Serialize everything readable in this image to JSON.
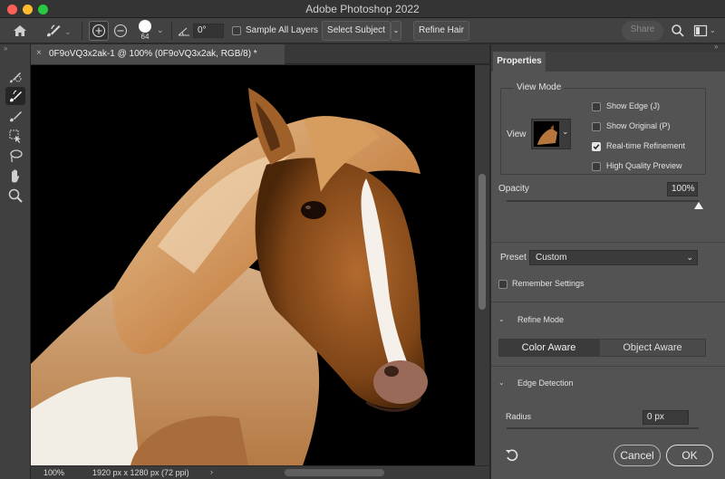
{
  "window": {
    "title": "Adobe Photoshop 2022",
    "traffic_colors": [
      "#ff5f57",
      "#febc2e",
      "#28c840"
    ]
  },
  "options_bar": {
    "brush_size": "64",
    "angle_value": "0°",
    "sample_all_layers_label": "Sample All Layers",
    "sample_all_layers_checked": false,
    "select_subject_label": "Select Subject",
    "refine_hair_label": "Refine Hair",
    "share_label": "Share"
  },
  "document": {
    "tab_title": "0F9oVQ3x2ak-1 @ 100% (0F9oVQ3x2ak, RGB/8) *"
  },
  "toolbar": {
    "tools": [
      {
        "name": "quick-selection-tool-icon",
        "active": false
      },
      {
        "name": "refine-edge-brush-icon",
        "active": true
      },
      {
        "name": "brush-tool-icon",
        "active": false
      },
      {
        "name": "object-selection-tool-icon",
        "active": false
      },
      {
        "name": "lasso-tool-icon",
        "active": false
      },
      {
        "name": "hand-tool-icon",
        "active": false
      },
      {
        "name": "zoom-tool-icon",
        "active": false
      }
    ]
  },
  "status_bar": {
    "zoom": "100%",
    "doc_info": "1920 px x 1280 px (72 ppi)"
  },
  "properties": {
    "tab_label": "Properties",
    "view_mode": {
      "heading": "View Mode",
      "view_label": "View",
      "options": [
        {
          "label": "Show Edge (J)",
          "checked": false
        },
        {
          "label": "Show Original (P)",
          "checked": false
        },
        {
          "label": "Real-time Refinement",
          "checked": true
        },
        {
          "label": "High Quality Preview",
          "checked": false
        }
      ]
    },
    "opacity": {
      "label": "Opacity",
      "value_text": "100%",
      "level": 1.0
    },
    "preset": {
      "label": "Preset",
      "value": "Custom"
    },
    "remember_settings_label": "Remember Settings",
    "refine_mode": {
      "heading": "Refine Mode",
      "options": [
        "Color Aware",
        "Object Aware"
      ],
      "selected": "Color Aware"
    },
    "edge_detection": {
      "heading": "Edge Detection",
      "radius_label": "Radius",
      "radius_value": "0 px"
    },
    "buttons": {
      "cancel": "Cancel",
      "ok": "OK"
    }
  }
}
